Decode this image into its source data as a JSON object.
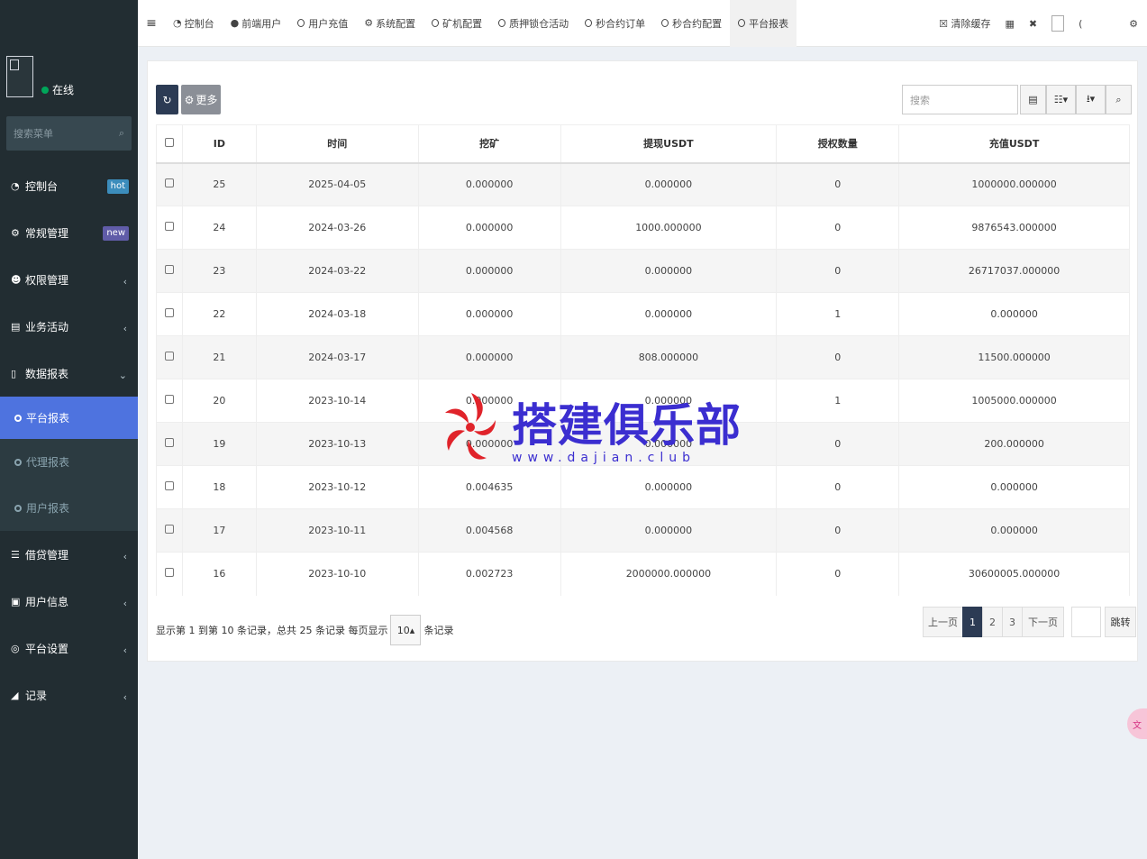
{
  "sidebar": {
    "status": "在线",
    "search_placeholder": "搜索菜单",
    "menu": [
      {
        "label": "控制台",
        "icon": "dashboard-icon",
        "badge": "hot"
      },
      {
        "label": "常规管理",
        "icon": "cogs-icon",
        "badge": "new"
      },
      {
        "label": "权限管理",
        "icon": "group-icon"
      },
      {
        "label": "业务活动",
        "icon": "list-alt-icon"
      },
      {
        "label": "数据报表",
        "icon": "file-icon"
      }
    ],
    "submenu": [
      {
        "label": "平台报表"
      },
      {
        "label": "代理报表"
      },
      {
        "label": "用户报表"
      }
    ],
    "menu2": [
      {
        "label": "借贷管理",
        "icon": "list-icon"
      },
      {
        "label": "用户信息",
        "icon": "book-icon"
      },
      {
        "label": "平台设置",
        "icon": "gear-icon"
      },
      {
        "label": "记录",
        "icon": "area-chart-icon"
      }
    ]
  },
  "topnav": {
    "tabs": [
      "控制台",
      "前端用户",
      "用户充值",
      "系统配置",
      "矿机配置",
      "质押锁仓活动",
      "秒合约订单",
      "秒合约配置",
      "平台报表"
    ],
    "clear_cache": "清除缓存"
  },
  "toolbar": {
    "more_label": "更多",
    "search_placeholder": "搜索"
  },
  "table": {
    "headers": [
      "ID",
      "时间",
      "挖矿",
      "提现USDT",
      "授权数量",
      "充值USDT"
    ],
    "rows": [
      [
        "25",
        "2025-04-05",
        "0.000000",
        "0.000000",
        "0",
        "1000000.000000"
      ],
      [
        "24",
        "2024-03-26",
        "0.000000",
        "1000.000000",
        "0",
        "9876543.000000"
      ],
      [
        "23",
        "2024-03-22",
        "0.000000",
        "0.000000",
        "0",
        "26717037.000000"
      ],
      [
        "22",
        "2024-03-18",
        "0.000000",
        "0.000000",
        "1",
        "0.000000"
      ],
      [
        "21",
        "2024-03-17",
        "0.000000",
        "808.000000",
        "0",
        "11500.000000"
      ],
      [
        "20",
        "2023-10-14",
        "0.000000",
        "0.000000",
        "1",
        "1005000.000000"
      ],
      [
        "19",
        "2023-10-13",
        "0.000000",
        "0.000000",
        "0",
        "200.000000"
      ],
      [
        "18",
        "2023-10-12",
        "0.004635",
        "0.000000",
        "0",
        "0.000000"
      ],
      [
        "17",
        "2023-10-11",
        "0.004568",
        "0.000000",
        "0",
        "0.000000"
      ],
      [
        "16",
        "2023-10-10",
        "0.002723",
        "2000000.000000",
        "0",
        "30600005.000000"
      ]
    ]
  },
  "footer": {
    "info": "显示第 1 到第 10 条记录，总共 25 条记录 每页显示",
    "page_size": "10",
    "info_suffix": "条记录"
  },
  "pagination": {
    "prev": "上一页",
    "pages": [
      "1",
      "2",
      "3"
    ],
    "next": "下一页",
    "jump": "跳转"
  },
  "watermark": {
    "title": "搭建俱乐部",
    "url": "www.dajian.club"
  },
  "colors": {
    "sidebar_bg": "#222d32",
    "active_blue": "#4e73df",
    "primary_dark": "#2c3b54",
    "online_green": "#00a65a",
    "watermark_blue": "#3b2ed0",
    "logo_red": "#e0232a"
  }
}
